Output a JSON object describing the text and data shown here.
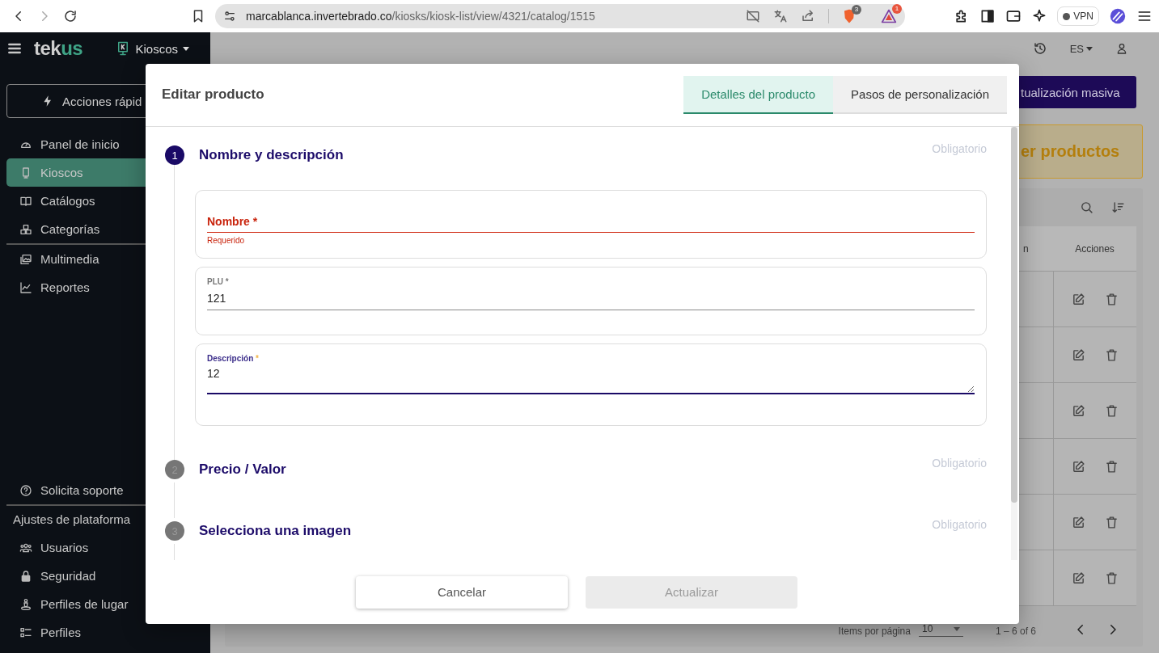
{
  "browser": {
    "url": {
      "host": "marcablanca.invertebrado.co",
      "path": "/kiosks/kiosk-list/view/4321/catalog/1515"
    },
    "badges": [
      "3",
      "1"
    ],
    "vpn": "VPN"
  },
  "app": {
    "logo": {
      "primary": "tek",
      "accent": "us"
    },
    "module": "Kioscos",
    "language": "ES"
  },
  "sidebar": {
    "quick_action": "Acciones rápid",
    "sections": [
      {
        "items": [
          {
            "label": "Panel de inicio",
            "selected": false
          },
          {
            "label": "Kioscos",
            "selected": true
          },
          {
            "label": "Catálogos",
            "selected": false
          },
          {
            "label": "Categorías",
            "selected": false
          }
        ]
      },
      {
        "items": [
          {
            "label": "Multimedia",
            "selected": false
          },
          {
            "label": "Reportes",
            "selected": false
          }
        ]
      }
    ],
    "bottom": [
      {
        "items": [
          {
            "label": "Solicita soporte",
            "selected": false
          }
        ]
      },
      {
        "heading": "Ajustes de plataforma",
        "items": [
          {
            "label": "Usuarios",
            "selected": false
          },
          {
            "label": "Seguridad",
            "selected": false
          },
          {
            "label": "Perfiles de lugar",
            "selected": false
          },
          {
            "label": "Perfiles",
            "selected": false
          }
        ]
      }
    ]
  },
  "main": {
    "bulk_button": "tualización masiva",
    "banner": "er productos",
    "table": {
      "column_3": "n",
      "actions_header": "Acciones",
      "rows": [
        {
          "kind": "actions"
        },
        {
          "kind": "actions"
        },
        {
          "kind": "actions"
        },
        {
          "kind": "actions"
        },
        {
          "kind": "actions"
        },
        {
          "kind": "actions"
        }
      ]
    },
    "pagination": {
      "label": "Items por página",
      "page_size": "10",
      "range": "1 – 6 of 6"
    }
  },
  "modal": {
    "title": "Editar producto",
    "tabs": [
      {
        "label": "Detalles del producto",
        "selected": true
      },
      {
        "label": "Pasos de personalización",
        "selected": false
      }
    ],
    "steps": [
      {
        "number": "1",
        "title": "Nombre y descripción",
        "hint": "Obligatorio",
        "active": true,
        "fields": [
          {
            "kind": "input",
            "label": "Nombre",
            "required_mark": "*",
            "invalid": true,
            "focused": false,
            "error": "Requerido"
          },
          {
            "kind": "input",
            "label": "PLU",
            "required_mark": "*",
            "value": "121",
            "invalid": false,
            "focused": false
          },
          {
            "kind": "textarea",
            "label": "Descripción",
            "required_mark": "*",
            "value": "12",
            "invalid": false,
            "focused": true
          }
        ]
      },
      {
        "number": "2",
        "title": "Precio / Valor",
        "hint": "Obligatorio",
        "active": false
      },
      {
        "number": "3",
        "title": "Selecciona una imagen",
        "hint": "Obligatorio",
        "active": false
      }
    ],
    "buttons": [
      {
        "label": "Cancelar",
        "disabled": false
      },
      {
        "label": "Actualizar",
        "disabled": true
      }
    ]
  }
}
